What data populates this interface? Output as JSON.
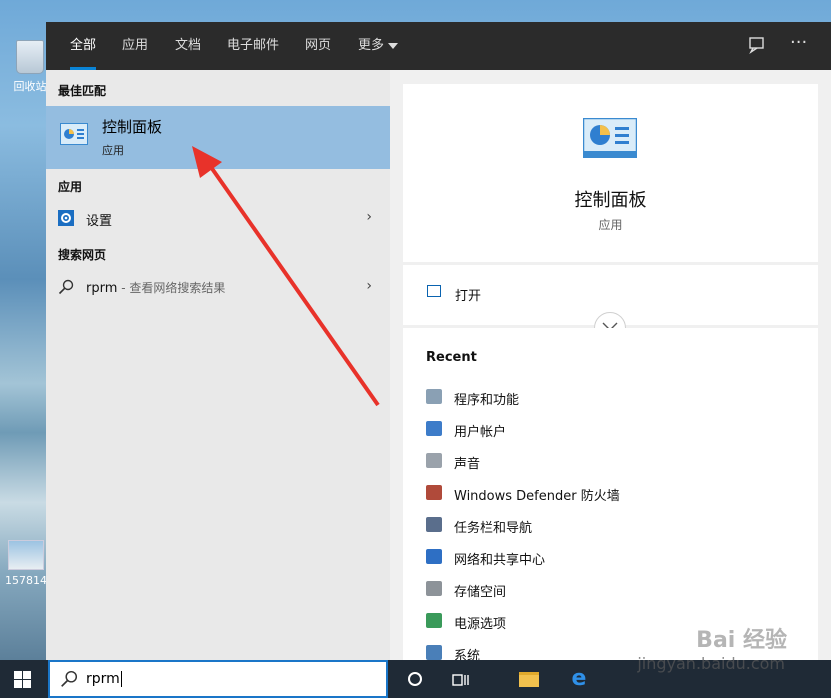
{
  "desktop": {
    "recycle_label": "回收站",
    "photo_label": "157814"
  },
  "tabs": [
    {
      "label": "全部"
    },
    {
      "label": "应用"
    },
    {
      "label": "文档"
    },
    {
      "label": "电子邮件"
    },
    {
      "label": "网页"
    },
    {
      "label": "更多"
    }
  ],
  "left": {
    "best_match_header": "最佳匹配",
    "best_match": {
      "title": "控制面板",
      "subtitle": "应用"
    },
    "apps_header": "应用",
    "settings_label": "设置",
    "web_header": "搜索网页",
    "web_query": "rprm",
    "web_hint": " - 查看网络搜索结果"
  },
  "right": {
    "title": "控制面板",
    "subtitle": "应用",
    "open_label": "打开",
    "recent_header": "Recent",
    "recent_items": [
      {
        "label": "程序和功能",
        "icon": "programs-icon",
        "color": "#8aa0b4"
      },
      {
        "label": "用户帐户",
        "icon": "users-icon",
        "color": "#3d7cc9"
      },
      {
        "label": "声音",
        "icon": "speaker-icon",
        "color": "#9aa2ab"
      },
      {
        "label": "Windows Defender 防火墙",
        "icon": "firewall-icon",
        "color": "#b04a3a"
      },
      {
        "label": "任务栏和导航",
        "icon": "taskbar-icon",
        "color": "#5a6e8c"
      },
      {
        "label": "网络和共享中心",
        "icon": "network-icon",
        "color": "#2e6fc4"
      },
      {
        "label": "存储空间",
        "icon": "storage-icon",
        "color": "#8d9399"
      },
      {
        "label": "电源选项",
        "icon": "power-icon",
        "color": "#3a9a5a"
      },
      {
        "label": "系统",
        "icon": "system-icon",
        "color": "#4a7fb8"
      }
    ]
  },
  "taskbar": {
    "search_value": "rprm"
  },
  "watermark": {
    "brand": "Bai 经验",
    "url": "jingyan.baidu.com"
  }
}
